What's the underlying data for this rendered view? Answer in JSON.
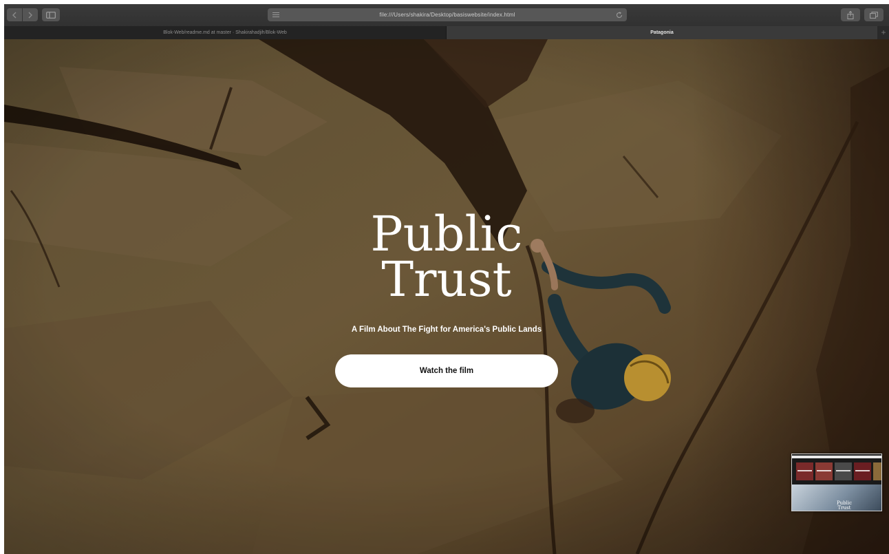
{
  "browser": {
    "url": "file:///Users/shakira/Desktop/basiswebsite/index.html",
    "tabs": [
      {
        "label": "Blok-Web/readme.md at master · Shakirahadjih/Blok-Web",
        "active": false
      },
      {
        "label": "Patagonia",
        "active": true
      }
    ],
    "new_tab_label": "+",
    "icons": {
      "back": "chevron-left-icon",
      "forward": "chevron-right-icon",
      "sidebar": "sidebar-icon",
      "reader": "reader-icon",
      "reload": "reload-icon",
      "share": "share-icon",
      "tabs": "tabs-overview-icon"
    }
  },
  "hero": {
    "title_line1": "Public",
    "title_line2": "Trust",
    "subtitle": "A Film About The Fight for America's Public Lands",
    "cta_label": "Watch the film"
  },
  "thumbnail": {
    "title_line1": "Public",
    "title_line2": "Trust"
  },
  "colors": {
    "cta_background": "#ffffff",
    "hero_text": "#ffffff",
    "rock_tone": "#6b5638"
  }
}
